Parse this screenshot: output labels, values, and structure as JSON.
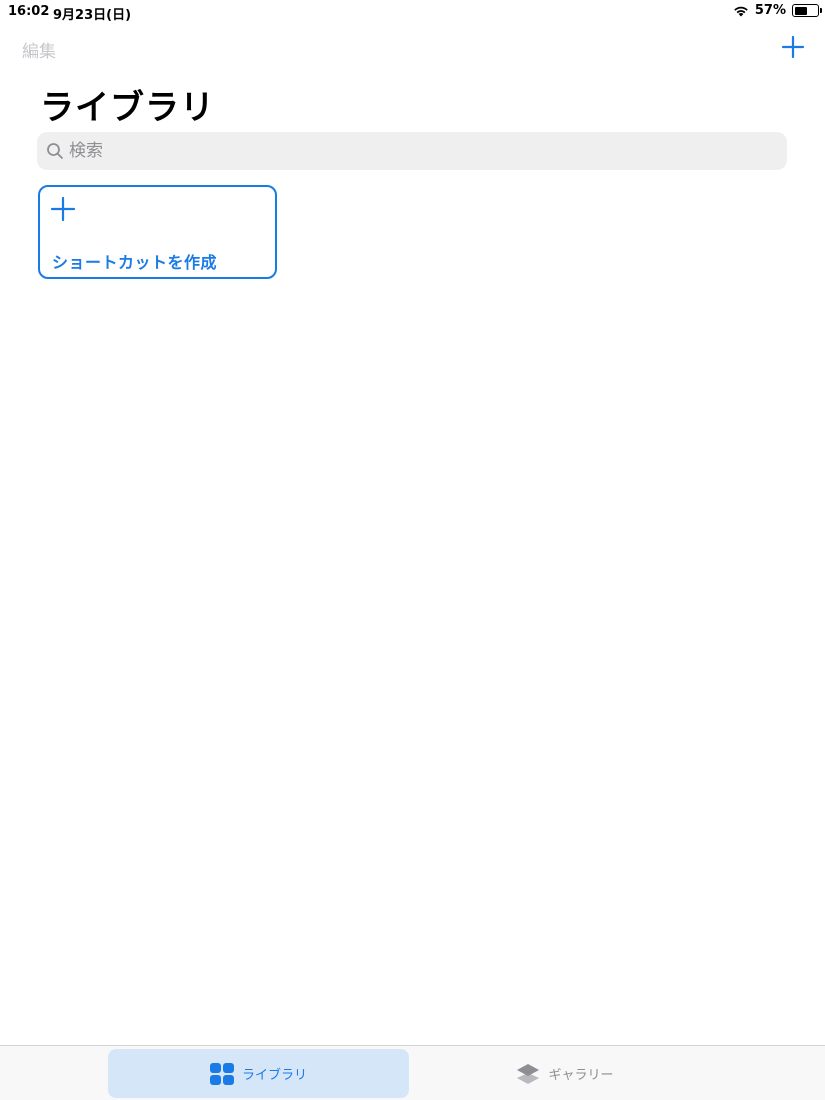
{
  "status": {
    "time": "16:02",
    "date": "9月23日(日)",
    "battery_percent": "57%",
    "battery_level": 0.57
  },
  "nav": {
    "edit_label": "編集",
    "add_icon": "plus-icon"
  },
  "page": {
    "title": "ライブラリ"
  },
  "search": {
    "placeholder": "検索",
    "value": ""
  },
  "create_card": {
    "label": "ショートカットを作成",
    "icon": "plus-icon"
  },
  "tabs": [
    {
      "label": "ライブラリ",
      "icon": "grid-icon",
      "selected": true
    },
    {
      "label": "ギャラリー",
      "icon": "layers-icon",
      "selected": false
    }
  ],
  "colors": {
    "accent": "#1a7be6",
    "disabled_text": "#c7c7cc",
    "search_background": "#efeff0",
    "tab_selected_background": "#d6e6f9",
    "tab_inactive": "#8e8e93"
  }
}
